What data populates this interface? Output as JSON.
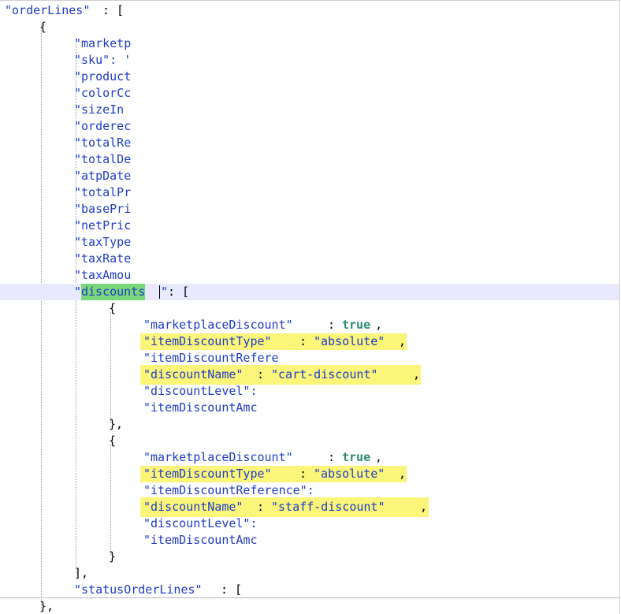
{
  "code": {
    "l1_key": "\"orderLines\"",
    "l1_rest": ": [",
    "l2": "{",
    "fields": [
      "\"marketp",
      "\"sku\": '",
      "\"product",
      "\"colorCc",
      "\"sizeIn",
      "\"orderec",
      "\"totalRe",
      "\"totalDe",
      "\"atpDate",
      "\"totalPr",
      "\"basePri",
      "\"netPric",
      "\"taxType",
      "\"taxRate",
      "\"taxAmou"
    ],
    "discounts_quote_open": "\"",
    "discounts_word": "discounts",
    "discounts_quote_close": "\"",
    "discounts_rest": ": [",
    "obj_open": "{",
    "obj_close_comma": "},",
    "obj_close": "}",
    "block1": {
      "marketplace_key": "\"marketplaceDiscount\"",
      "marketplace_colon": ": ",
      "marketplace_val": "true",
      "marketplace_comma": ",",
      "type_key": "\"itemDiscountType\"",
      "type_colon": ": ",
      "type_val": "\"absolute\"",
      "type_comma": ",",
      "reference": "\"itemDiscountRefere",
      "name_key": "\"discountName\"",
      "name_colon": ": ",
      "name_val": "\"cart-discount\"",
      "name_comma": ",",
      "level": "\"discountLevel\":",
      "amount": "\"itemDiscountAmc"
    },
    "block2": {
      "marketplace_key": "\"marketplaceDiscount\"",
      "marketplace_colon": ": ",
      "marketplace_val": "true",
      "marketplace_comma": ",",
      "type_key": "\"itemDiscountType\"",
      "type_colon": ": ",
      "type_val": "\"absolute\"",
      "type_comma": ",",
      "reference": "\"itemDiscountReference\":",
      "name_key": "\"discountName\"",
      "name_colon": ": ",
      "name_val": "\"staff-discount\"",
      "name_comma": ",",
      "level": "\"discountLevel\":",
      "amount": "\"itemDiscountAmc"
    },
    "array_close": "],",
    "status_key": "\"statusOrderLines\"",
    "status_rest": ": [",
    "final_close": "},"
  },
  "colors": {
    "string": "#1e3cc8",
    "keyword": "#2e8b74",
    "yellow_highlight": "#fbf57a",
    "green_highlight": "#7ad67a",
    "current_line": "#e8e8ff"
  }
}
